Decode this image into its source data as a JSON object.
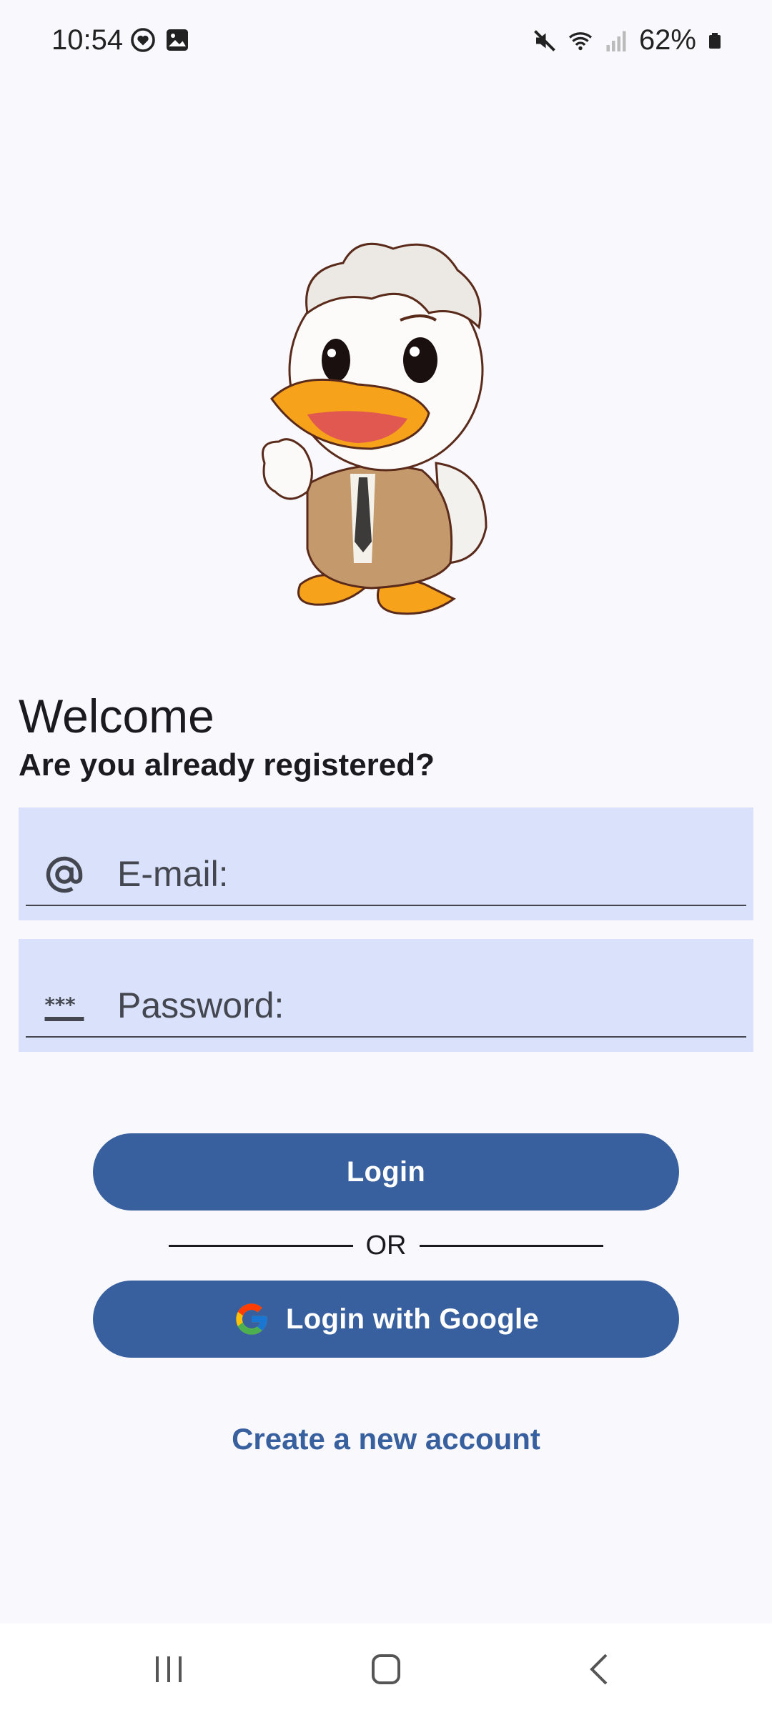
{
  "status_bar": {
    "time": "10:54",
    "battery": "62%",
    "left_icons": [
      "location-heart-icon",
      "image-icon"
    ],
    "right_icons": [
      "mute-icon",
      "wifi-icon",
      "signal-icon",
      "battery-icon"
    ]
  },
  "mascot": {
    "icon": "duck-mascot-illustration"
  },
  "header": {
    "title": "Welcome",
    "subtitle": "Are you already registered?"
  },
  "form": {
    "email_label": "E-mail:",
    "password_label": "Password:"
  },
  "actions": {
    "login_label": "Login",
    "or_label": "OR",
    "google_label": "Login with Google",
    "create_account_label": "Create a new account"
  },
  "colors": {
    "background": "#f9f8fd",
    "primary": "#385f9e",
    "field_bg": "#dae2fb",
    "text": "#1b1b1f"
  }
}
